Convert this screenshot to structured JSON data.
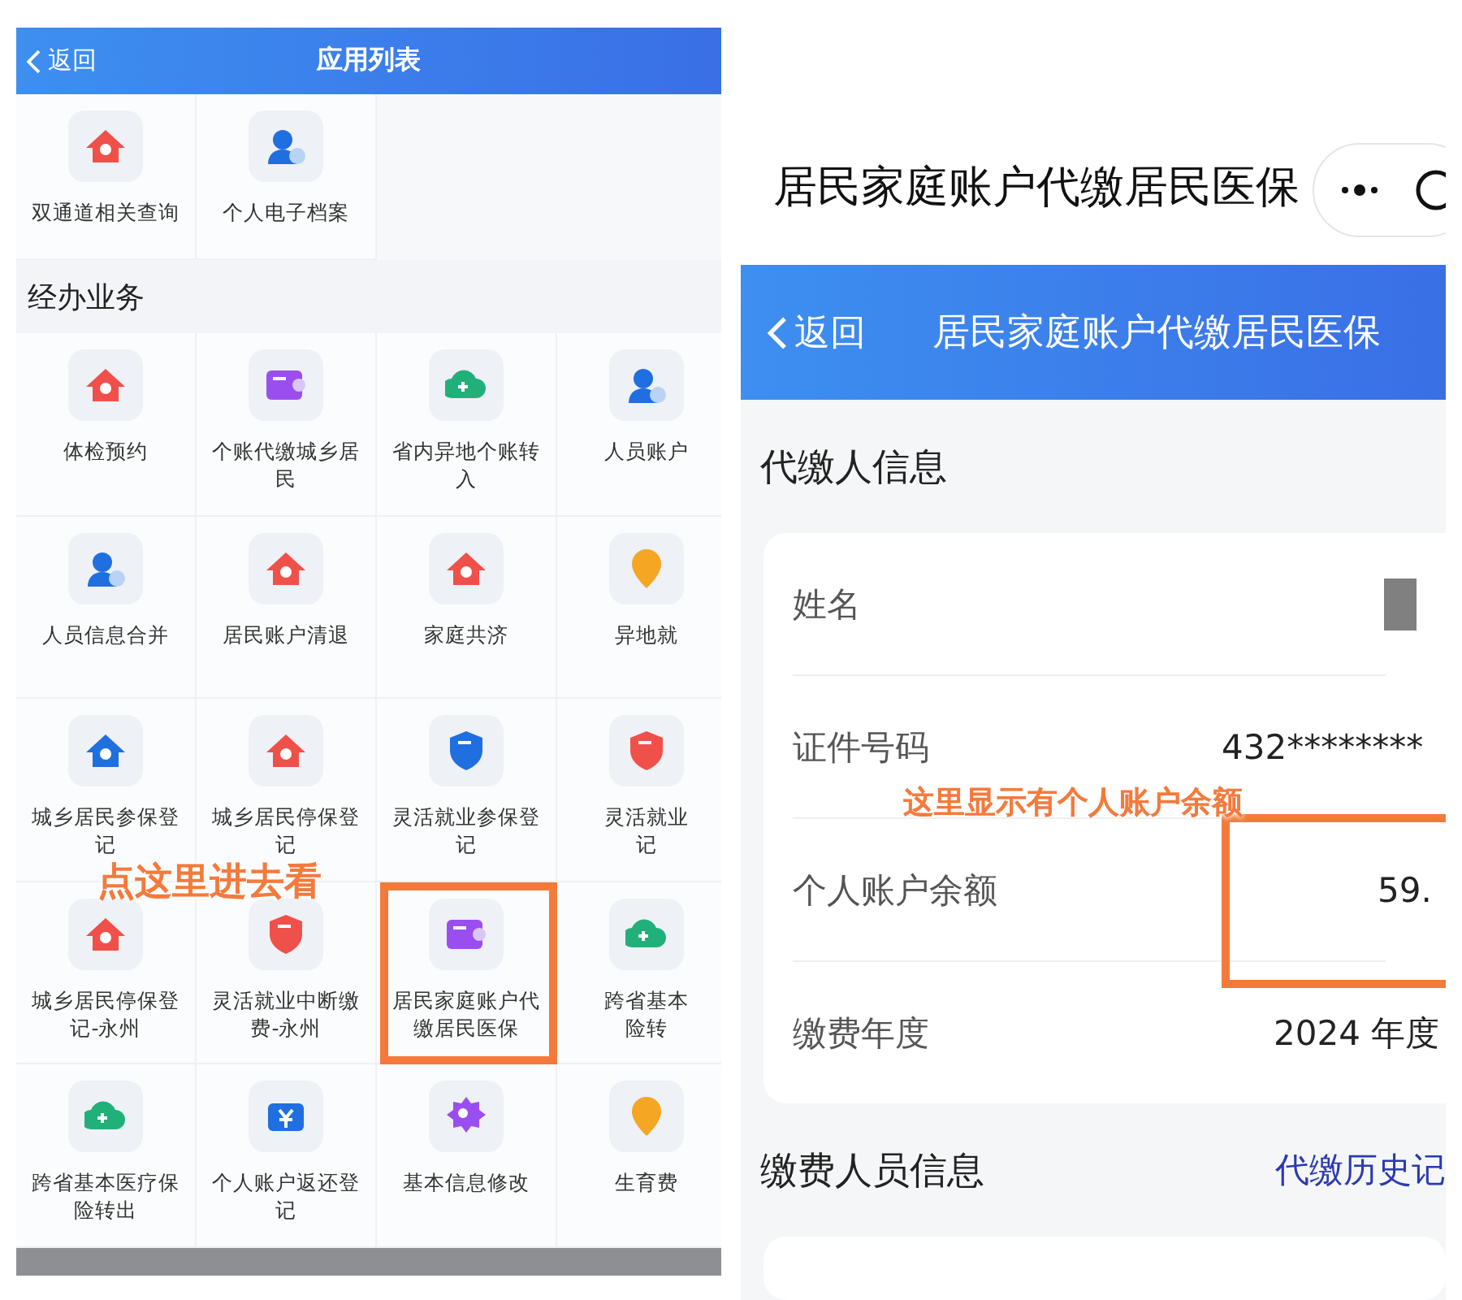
{
  "left_screen": {
    "back": "返回",
    "title": "应用列表",
    "top_items": [
      {
        "label": "双通道相关查询",
        "kind": "house",
        "color": "#f0504a",
        "highlighted": false
      },
      {
        "label": "个人电子档案",
        "kind": "person",
        "color": "#1f6fe0",
        "highlighted": false
      }
    ],
    "section_title": "经办业务",
    "items": [
      {
        "label": "体检预约",
        "kind": "house",
        "color": "#f0504a",
        "highlighted": false
      },
      {
        "label": "个账代缴城乡居民",
        "kind": "wallet",
        "color": "#9b4ef0",
        "highlighted": false
      },
      {
        "label": "省内异地个账转入",
        "kind": "cloud",
        "color": "#22b07a",
        "highlighted": false
      },
      {
        "label": "人员账户",
        "kind": "person",
        "color": "#1f6fe0",
        "highlighted": false
      },
      {
        "label": "人员信息合并",
        "kind": "person",
        "color": "#1f6fe0",
        "highlighted": false
      },
      {
        "label": "居民账户清退",
        "kind": "house",
        "color": "#f0504a",
        "highlighted": false
      },
      {
        "label": "家庭共济",
        "kind": "house",
        "color": "#f0504a",
        "highlighted": false
      },
      {
        "label": "异地就",
        "kind": "pin",
        "color": "#f5a623",
        "highlighted": false
      },
      {
        "label": "城乡居民参保登记",
        "kind": "house",
        "color": "#1f6fe0",
        "highlighted": false
      },
      {
        "label": "城乡居民停保登记",
        "kind": "house",
        "color": "#f0504a",
        "highlighted": false
      },
      {
        "label": "灵活就业参保登记",
        "kind": "shield",
        "color": "#1f6fe0",
        "highlighted": false
      },
      {
        "label": "灵活就业记",
        "kind": "shield",
        "color": "#f0504a",
        "highlighted": false
      },
      {
        "label": "城乡居民停保登记-永州",
        "kind": "house",
        "color": "#f0504a",
        "highlighted": false
      },
      {
        "label": "灵活就业中断缴费-永州",
        "kind": "shield",
        "color": "#f0504a",
        "highlighted": false
      },
      {
        "label": "居民家庭账户代缴居民医保",
        "kind": "wallet",
        "color": "#9b4ef0",
        "highlighted": true
      },
      {
        "label": "跨省基本险转",
        "kind": "cloud",
        "color": "#22b07a",
        "highlighted": false
      },
      {
        "label": "跨省基本医疗保险转出",
        "kind": "cloud",
        "color": "#22b07a",
        "highlighted": false
      },
      {
        "label": "个人账户返还登记",
        "kind": "yen",
        "color": "#1f6fe0",
        "highlighted": false
      },
      {
        "label": "基本信息修改",
        "kind": "gear",
        "color": "#9b4ef0",
        "highlighted": false
      },
      {
        "label": "生育费",
        "kind": "pin",
        "color": "#f5a623",
        "highlighted": false
      }
    ],
    "annotation": "点这里进去看"
  },
  "right_screen": {
    "app_title": "居民家庭账户代缴居民医保",
    "back": "返回",
    "title": "居民家庭账户代缴居民医保",
    "payer_section": "代缴人信息",
    "fields": [
      {
        "label": "姓名",
        "kind": "masked",
        "highlighted": false
      },
      {
        "label": "证件号码",
        "kind": "text",
        "value": "432********",
        "highlighted": false
      },
      {
        "label": "个人账户余额",
        "kind": "text",
        "value": "59.",
        "highlighted": true
      },
      {
        "label": "缴费年度",
        "kind": "select",
        "value": "2024 年度",
        "highlighted": false
      }
    ],
    "annotation": "这里显示有个人账户余额",
    "members_section": "缴费人员信息",
    "history_link": "代缴历史记"
  }
}
